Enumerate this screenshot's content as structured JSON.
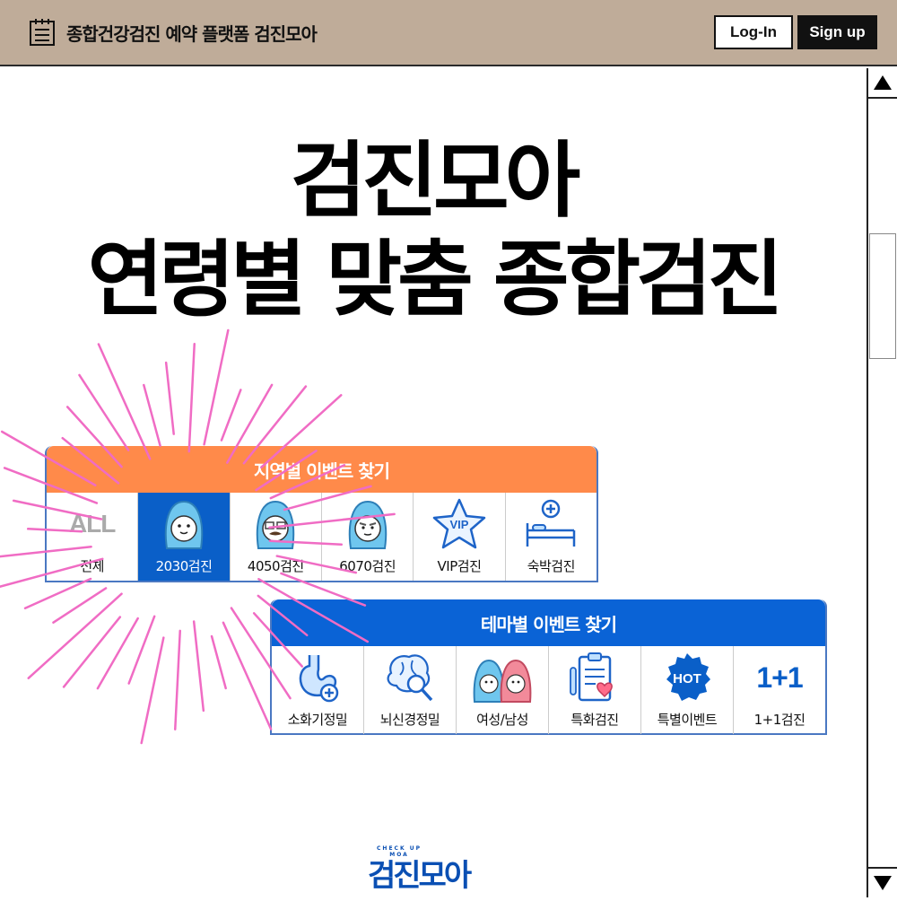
{
  "header": {
    "title": "종합건강검진 예약 플랫폼 검진모아",
    "login_label": "Log-In",
    "signup_label": "Sign up"
  },
  "hero": {
    "line1": "검진모아",
    "line2": "연령별 맞춤 종합검진"
  },
  "region_panel": {
    "title": "지역별 이벤트 찾기",
    "items": [
      {
        "label": "전체",
        "icon": "all-text-icon",
        "icon_text": "ALL",
        "active": false
      },
      {
        "label": "2030검진",
        "icon": "character-2030-icon",
        "active": true
      },
      {
        "label": "4050검진",
        "icon": "character-4050-icon",
        "active": false
      },
      {
        "label": "6070검진",
        "icon": "character-6070-icon",
        "active": false
      },
      {
        "label": "VIP검진",
        "icon": "vip-star-icon",
        "icon_text": "VIP",
        "active": false
      },
      {
        "label": "숙박검진",
        "icon": "hospital-bed-icon",
        "active": false
      }
    ]
  },
  "theme_panel": {
    "title": "테마별 이벤트 찾기",
    "items": [
      {
        "label": "소화기정밀",
        "icon": "stomach-icon"
      },
      {
        "label": "뇌신경정밀",
        "icon": "brain-search-icon"
      },
      {
        "label": "여성/남성",
        "icon": "couple-characters-icon"
      },
      {
        "label": "특화검진",
        "icon": "clipboard-heart-icon"
      },
      {
        "label": "특별이벤트",
        "icon": "hot-badge-icon",
        "icon_text": "HOT"
      },
      {
        "label": "1+1검진",
        "icon": "one-plus-one-icon",
        "icon_text": "1+1"
      }
    ]
  },
  "footer_logo": {
    "small_text": "CHECK UP MOA",
    "main_text": "검진모아"
  },
  "colors": {
    "header_bg": "#bfac99",
    "region_head": "#ff8a4a",
    "theme_head": "#0a63d6",
    "active_cell": "#0a5fc8",
    "burst": "#f06cc4",
    "brand_blue": "#0a4fb3"
  }
}
